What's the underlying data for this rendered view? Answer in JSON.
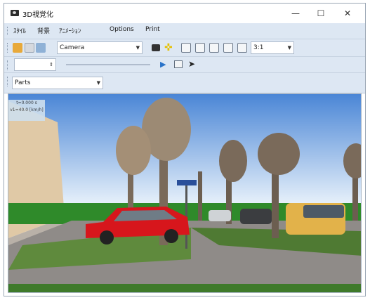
{
  "window": {
    "title": "3D視覚化"
  },
  "title_controls": {
    "minimize": "—",
    "maximize": "☐",
    "close": "✕"
  },
  "menu": {
    "items": [
      "ｽﾀｲﾙ",
      "背景",
      "ｱﾆﾒｰｼｮﾝ",
      "Options",
      "Print"
    ]
  },
  "toolbar": {
    "camera_value": "Camera",
    "ratio_value": "3:1"
  },
  "parts": {
    "value": "Parts"
  },
  "viewport": {
    "overlay_line1": "t=0.000 s",
    "overlay_line2": "v1=40.0 [km/h]"
  },
  "colors": {
    "menubar": "#dde7f3",
    "sky_top": "#4a86d6",
    "sky_bottom": "#eaf3fb",
    "grass": "#2f8a2a",
    "road": "#8f8b88",
    "car_red": "#d7161c"
  }
}
